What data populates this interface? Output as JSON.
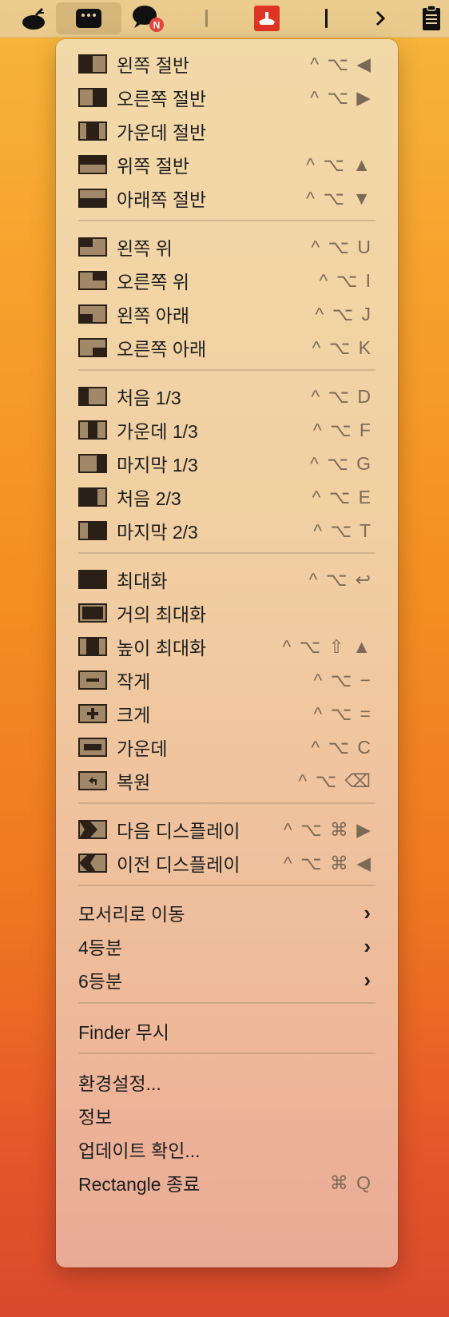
{
  "menubar": {
    "items": [
      "app-icon",
      "rectangle-icon",
      "chat-icon",
      "divider",
      "screen-icon",
      "text-cursor",
      "chevron-right",
      "clipboard-icon"
    ],
    "chat_badge": "N"
  },
  "menu": {
    "halves": [
      {
        "label": "왼쪽 절반",
        "shortcut": "^ ⌥ ◀"
      },
      {
        "label": "오른쪽 절반",
        "shortcut": "^ ⌥ ▶"
      },
      {
        "label": "가운데 절반",
        "shortcut": ""
      },
      {
        "label": "위쪽 절반",
        "shortcut": "^ ⌥ ▲"
      },
      {
        "label": "아래쪽 절반",
        "shortcut": "^ ⌥ ▼"
      }
    ],
    "corners": [
      {
        "label": "왼쪽 위",
        "shortcut": "^ ⌥ U"
      },
      {
        "label": "오른쪽 위",
        "shortcut": "^ ⌥ I"
      },
      {
        "label": "왼쪽 아래",
        "shortcut": "^ ⌥ J"
      },
      {
        "label": "오른쪽 아래",
        "shortcut": "^ ⌥ K"
      }
    ],
    "thirds": [
      {
        "label": "처음 1/3",
        "shortcut": "^ ⌥ D"
      },
      {
        "label": "가운데 1/3",
        "shortcut": "^ ⌥ F"
      },
      {
        "label": "마지막 1/3",
        "shortcut": "^ ⌥ G"
      },
      {
        "label": "처음 2/3",
        "shortcut": "^ ⌥ E"
      },
      {
        "label": "마지막 2/3",
        "shortcut": "^ ⌥ T"
      }
    ],
    "sizing": [
      {
        "label": "최대화",
        "shortcut": "^ ⌥ ↩"
      },
      {
        "label": "거의 최대화",
        "shortcut": ""
      },
      {
        "label": "높이 최대화",
        "shortcut": "^ ⌥ ⇧ ▲"
      },
      {
        "label": "작게",
        "shortcut": "^ ⌥ −"
      },
      {
        "label": "크게",
        "shortcut": "^ ⌥ ="
      },
      {
        "label": "가운데",
        "shortcut": "^ ⌥ C"
      },
      {
        "label": "복원",
        "shortcut": "^ ⌥ ⌫"
      }
    ],
    "displays": [
      {
        "label": "다음 디스플레이",
        "shortcut": "^ ⌥ ⌘ ▶"
      },
      {
        "label": "이전 디스플레이",
        "shortcut": "^ ⌥ ⌘ ◀"
      }
    ],
    "submenus": [
      {
        "label": "모서리로 이동"
      },
      {
        "label": "4등분"
      },
      {
        "label": "6등분"
      }
    ],
    "ignore": {
      "label": "Finder 무시"
    },
    "app": [
      {
        "label": "환경설정...",
        "shortcut": ""
      },
      {
        "label": "정보",
        "shortcut": ""
      },
      {
        "label": "업데이트 확인...",
        "shortcut": ""
      },
      {
        "label": "Rectangle 종료",
        "shortcut": "⌘ Q"
      }
    ]
  },
  "colors": {
    "icon_fill_dark": "#2a2018",
    "icon_fill_light": "#a08868",
    "shortcut_text": "#7b6a58",
    "label_text": "#1e1e1e"
  }
}
